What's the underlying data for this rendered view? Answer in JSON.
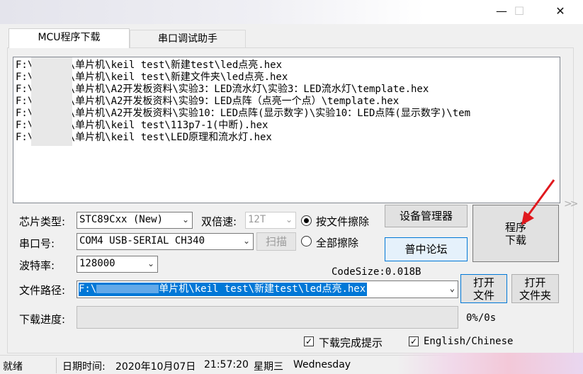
{
  "window": {
    "minimize_glyph": "—",
    "maximize_glyph": "☐",
    "close_glyph": "✕"
  },
  "tabs": [
    {
      "label": "MCU程序下载",
      "active": true
    },
    {
      "label": "串口调试助手",
      "active": false
    }
  ],
  "file_list": [
    "F:\\      的网课\\单片机\\keil   test\\新建test\\led点亮.hex",
    "F:\\      的网课\\单片机\\keil   test\\新建文件夹\\led点亮.hex",
    "F:\\      的网课\\单片机\\A2开发板资料\\实验3：LED流水灯\\实验3：LED流水灯\\template.hex",
    "F:\\      的网课\\单片机\\A2开发板资料\\实验9：LED点阵（点亮一个点）\\template.hex",
    "F:\\      的网课\\单片机\\A2开发板资料\\实验10：LED点阵(显示数字)\\实验10：LED点阵(显示数字)\\tem",
    "F:\\      的网课\\单片机\\keil   test\\113p7-1(中断).hex",
    "F:\\      的网课\\单片机\\keil   test\\LED原理和流水灯.hex"
  ],
  "scroll_hint": ">>",
  "form": {
    "chip_label": "芯片类型:",
    "chip_value": "STC89Cxx (New)",
    "double_speed_label": "双倍速:",
    "double_speed_value": "12T",
    "radio_erase_by_file": "按文件擦除",
    "radio_erase_all": "全部擦除",
    "port_label": "串口号:",
    "port_value": "COM4  USB-SERIAL CH340",
    "scan_button": "扫描",
    "baud_label": "波特率:",
    "baud_value": "128000",
    "codesize": "CodeSize:0.018B",
    "path_label": "文件路径:",
    "path_prefix": "F:\\",
    "path_value": "单片机\\keil   test\\新建test\\led点亮.hex",
    "progress_label": "下载进度:",
    "progress_fraction": 0,
    "progress_text": "0%/0s",
    "notify_label": "下载完成提示",
    "notify_checked": true,
    "lang_label": "English/Chinese",
    "lang_checked": true
  },
  "buttons": {
    "device_manager": "设备管理器",
    "forum": "普中论坛",
    "program_line1": "程序",
    "program_line2": "下载",
    "open_file_line1": "打开",
    "open_file_line2": "文件",
    "open_folder_line1": "打开",
    "open_folder_line2": "文件夹"
  },
  "dropdown_arrow": "⌄",
  "status": {
    "ready": "就绪",
    "datetime_label": "日期时间:",
    "date": "2020年10月07日",
    "time": "21:57:20",
    "weekday_cn": "星期三",
    "weekday_en": "Wednesday"
  },
  "colors": {
    "selection": "#0078d7",
    "accent_border": "#0078d7",
    "annotation_arrow": "#e0191e"
  }
}
